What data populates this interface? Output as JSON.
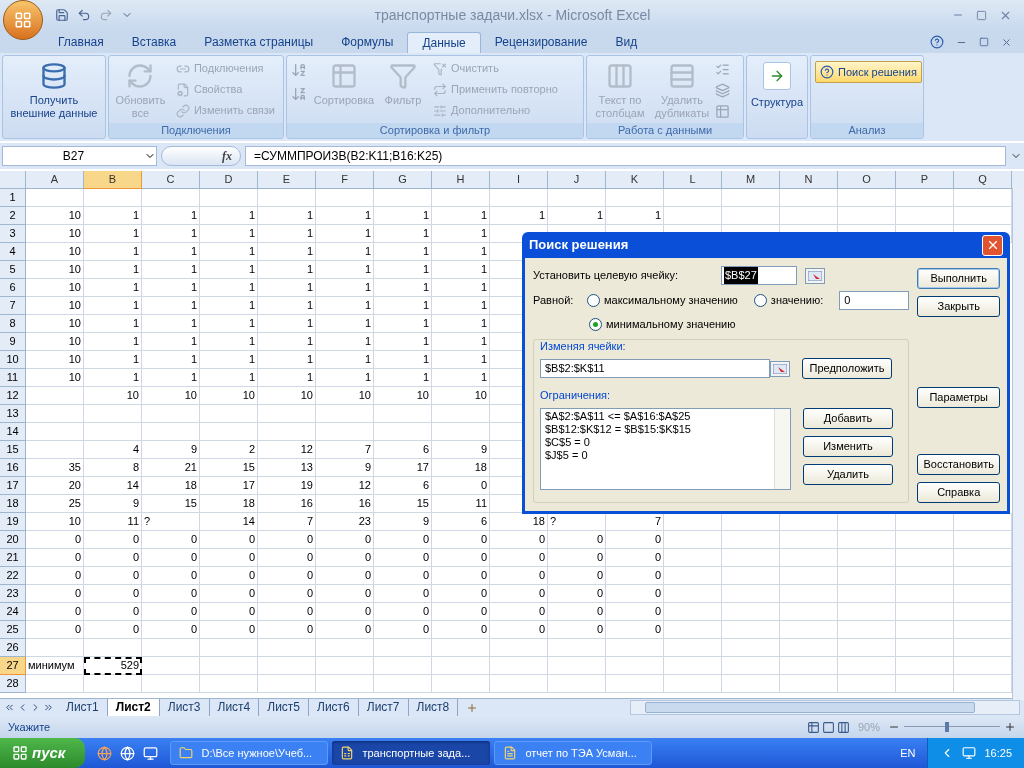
{
  "window": {
    "title": "транспортные задачи.xlsx - Microsoft Excel"
  },
  "ribbon_tabs": [
    {
      "label": "Главная",
      "selected": false
    },
    {
      "label": "Вставка",
      "selected": false
    },
    {
      "label": "Разметка страницы",
      "selected": false
    },
    {
      "label": "Формулы",
      "selected": false
    },
    {
      "label": "Данные",
      "selected": true
    },
    {
      "label": "Рецензирование",
      "selected": false
    },
    {
      "label": "Вид",
      "selected": false
    }
  ],
  "ribbon": {
    "get_data": {
      "label": "Получить внешние данные",
      "disabled": false
    },
    "connections": {
      "label": "Подключения",
      "refresh": {
        "label": "Обновить все",
        "disabled": true
      },
      "items": [
        {
          "label": "Подключения",
          "disabled": true
        },
        {
          "label": "Свойства",
          "disabled": true
        },
        {
          "label": "Изменить связи",
          "disabled": true
        }
      ]
    },
    "sort_filter": {
      "label": "Сортировка и фильтр",
      "sort": {
        "label": "Сортировка",
        "disabled": true
      },
      "filter": {
        "label": "Фильтр",
        "disabled": true
      },
      "items": [
        {
          "label": "Очистить",
          "disabled": true
        },
        {
          "label": "Применить повторно",
          "disabled": true
        },
        {
          "label": "Дополнительно",
          "disabled": true
        }
      ]
    },
    "data_tools": {
      "label": "Работа с данными",
      "text_to_columns": {
        "label": "Текст по столбцам",
        "disabled": true
      },
      "remove_duplicates": {
        "label": "Удалить дубликаты",
        "disabled": true
      }
    },
    "outline": {
      "label": "Структура",
      "disabled": false
    },
    "analysis": {
      "label": "Анализ",
      "solver": {
        "label": "Поиск решения",
        "disabled": false
      }
    }
  },
  "formula_bar": {
    "name_box": "B27",
    "function_label": "fx",
    "formula": "=СУММПРОИЗВ(B2:K11;B16:K25)"
  },
  "columns": [
    {
      "label": "A",
      "selected": false
    },
    {
      "label": "B",
      "selected": true
    },
    {
      "label": "C",
      "selected": false
    },
    {
      "label": "D",
      "selected": false
    },
    {
      "label": "E",
      "selected": false
    },
    {
      "label": "F",
      "selected": false
    },
    {
      "label": "G",
      "selected": false
    },
    {
      "label": "H",
      "selected": false
    },
    {
      "label": "I",
      "selected": false
    },
    {
      "label": "J",
      "selected": false
    },
    {
      "label": "K",
      "selected": false
    },
    {
      "label": "L",
      "selected": false
    },
    {
      "label": "M",
      "selected": false
    },
    {
      "label": "N",
      "selected": false
    },
    {
      "label": "O",
      "selected": false
    },
    {
      "label": "P",
      "selected": false
    },
    {
      "label": "Q",
      "selected": false
    }
  ],
  "rows": [
    {
      "number": "1",
      "selected": false
    },
    {
      "number": "2",
      "selected": false,
      "cells": [
        "10",
        "1",
        "1",
        "1",
        "1",
        "1",
        "1",
        "1",
        "1",
        "1",
        "1"
      ]
    },
    {
      "number": "3",
      "selected": false,
      "cells": [
        "10",
        "1",
        "1",
        "1",
        "1",
        "1",
        "1",
        "1"
      ]
    },
    {
      "number": "4",
      "selected": false,
      "cells": [
        "10",
        "1",
        "1",
        "1",
        "1",
        "1",
        "1",
        "1"
      ]
    },
    {
      "number": "5",
      "selected": false,
      "cells": [
        "10",
        "1",
        "1",
        "1",
        "1",
        "1",
        "1",
        "1"
      ]
    },
    {
      "number": "6",
      "selected": false,
      "cells": [
        "10",
        "1",
        "1",
        "1",
        "1",
        "1",
        "1",
        "1"
      ]
    },
    {
      "number": "7",
      "selected": false,
      "cells": [
        "10",
        "1",
        "1",
        "1",
        "1",
        "1",
        "1",
        "1"
      ]
    },
    {
      "number": "8",
      "selected": false,
      "cells": [
        "10",
        "1",
        "1",
        "1",
        "1",
        "1",
        "1",
        "1"
      ]
    },
    {
      "number": "9",
      "selected": false,
      "cells": [
        "10",
        "1",
        "1",
        "1",
        "1",
        "1",
        "1",
        "1"
      ]
    },
    {
      "number": "10",
      "selected": false,
      "cells": [
        "10",
        "1",
        "1",
        "1",
        "1",
        "1",
        "1",
        "1"
      ]
    },
    {
      "number": "11",
      "selected": false,
      "cells": [
        "10",
        "1",
        "1",
        "1",
        "1",
        "1",
        "1",
        "1"
      ]
    },
    {
      "number": "12",
      "selected": false,
      "cells": [
        null,
        "10",
        "10",
        "10",
        "10",
        "10",
        "10",
        "10"
      ]
    },
    {
      "number": "13",
      "selected": false
    },
    {
      "number": "14",
      "selected": false
    },
    {
      "number": "15",
      "selected": false,
      "cells": [
        null,
        "4",
        "9",
        "2",
        "12",
        "7",
        "6",
        "9"
      ]
    },
    {
      "number": "16",
      "selected": false,
      "cells": [
        "35",
        "8",
        "21",
        "15",
        "13",
        "9",
        "17",
        "18"
      ]
    },
    {
      "number": "17",
      "selected": false,
      "cells": [
        "20",
        "14",
        "18",
        "17",
        "19",
        "12",
        "6",
        "0"
      ]
    },
    {
      "number": "18",
      "selected": false,
      "cells": [
        "25",
        "9",
        "15",
        "18",
        "16",
        "16",
        "15",
        "11"
      ]
    },
    {
      "number": "19",
      "selected": false,
      "cells": [
        "10",
        "11",
        {
          "kind": "label",
          "text": "?"
        },
        "14",
        "7",
        "23",
        "9",
        "6",
        "18",
        {
          "kind": "label",
          "text": "?"
        },
        "7"
      ]
    },
    {
      "number": "20",
      "selected": false,
      "cells": [
        "0",
        "0",
        "0",
        "0",
        "0",
        "0",
        "0",
        "0",
        "0",
        "0",
        "0"
      ]
    },
    {
      "number": "21",
      "selected": false,
      "cells": [
        "0",
        "0",
        "0",
        "0",
        "0",
        "0",
        "0",
        "0",
        "0",
        "0",
        "0"
      ]
    },
    {
      "number": "22",
      "selected": false,
      "cells": [
        "0",
        "0",
        "0",
        "0",
        "0",
        "0",
        "0",
        "0",
        "0",
        "0",
        "0"
      ]
    },
    {
      "number": "23",
      "selected": false,
      "cells": [
        "0",
        "0",
        "0",
        "0",
        "0",
        "0",
        "0",
        "0",
        "0",
        "0",
        "0"
      ]
    },
    {
      "number": "24",
      "selected": false,
      "cells": [
        "0",
        "0",
        "0",
        "0",
        "0",
        "0",
        "0",
        "0",
        "0",
        "0",
        "0"
      ]
    },
    {
      "number": "25",
      "selected": false,
      "cells": [
        "0",
        "0",
        "0",
        "0",
        "0",
        "0",
        "0",
        "0",
        "0",
        "0",
        "0"
      ]
    },
    {
      "number": "26",
      "selected": false
    },
    {
      "number": "27",
      "selected": true,
      "cells": [
        {
          "kind": "label",
          "text": "минимум"
        },
        "529"
      ]
    },
    {
      "number": "28",
      "selected": false
    }
  ],
  "dialog": {
    "title": "Поиск решения",
    "target_label": "Установить целевую ячейку:",
    "target_value": "$B$27",
    "equal_label": "Равной:",
    "options": [
      {
        "label": "максимальному значению",
        "selected": false
      },
      {
        "label": "значению:",
        "selected": false
      },
      {
        "label": "минимальному значению",
        "selected": true
      }
    ],
    "value": "0",
    "changing_label": "Изменяя ячейки:",
    "changing_value": "$B$2:$K$11",
    "guess_button": "Предположить",
    "constraints_label": "Ограничения:",
    "constraints": [
      "$A$2:$A$11 <= $A$16:$A$25",
      "$B$12:$K$12 = $B$15:$K$15",
      "$C$5 = 0",
      "$J$5 = 0"
    ],
    "constraint_buttons": [
      "Добавить",
      "Изменить",
      "Удалить"
    ],
    "buttons": [
      "Выполнить",
      "Закрыть",
      "Параметры",
      "Восстановить",
      "Справка"
    ]
  },
  "sheet_tabs": [
    {
      "label": "Лист1",
      "selected": false
    },
    {
      "label": "Лист2",
      "selected": true
    },
    {
      "label": "Лист3",
      "selected": false
    },
    {
      "label": "Лист4",
      "selected": false
    },
    {
      "label": "Лист5",
      "selected": false
    },
    {
      "label": "Лист6",
      "selected": false
    },
    {
      "label": "Лист7",
      "selected": false
    },
    {
      "label": "Лист8",
      "selected": false
    }
  ],
  "status_bar": {
    "mode": "Укажите",
    "zoom": "90%",
    "zoom_slider": {
      "level": 0.45
    }
  },
  "taskbar": {
    "start": "пуск",
    "tasks": [
      {
        "label": "D:\\Все нужное\\Учеб...",
        "kind": "folder",
        "selected": false
      },
      {
        "label": "транспортные зада...",
        "kind": "excel",
        "selected": true
      },
      {
        "label": "отчет по ТЭА Усман...",
        "kind": "word",
        "selected": false
      }
    ],
    "language": "EN",
    "time": "16:25"
  }
}
